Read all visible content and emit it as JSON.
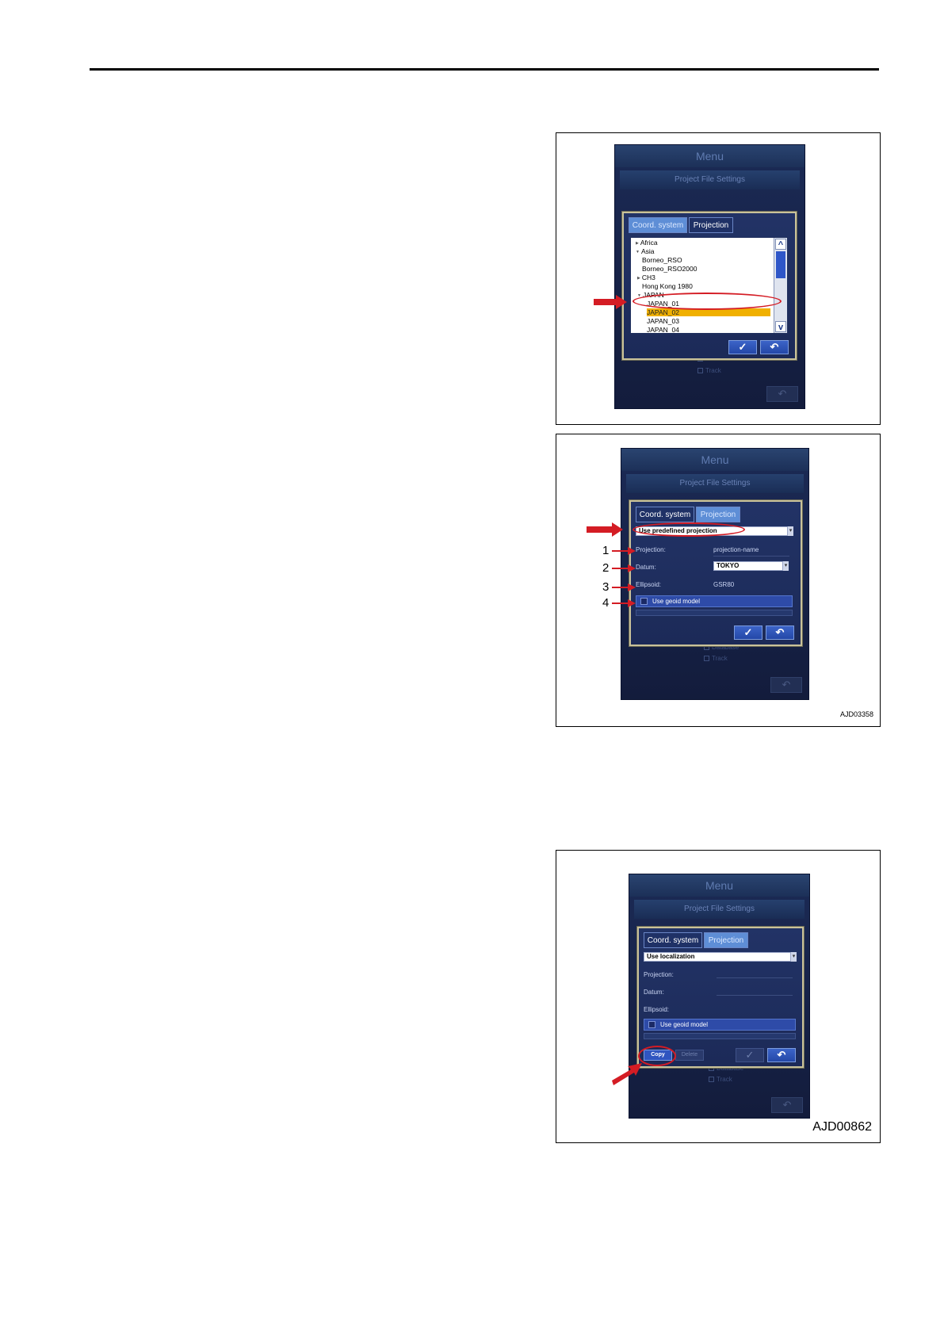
{
  "figure1": {
    "screen": {
      "menu_title": "Menu",
      "section_title": "Project File Settings",
      "tabs": [
        {
          "label": "Coord. system",
          "active": true
        },
        {
          "label": "Projection",
          "active": false
        }
      ],
      "tree_items": [
        {
          "label": "Africa",
          "expandable": true,
          "level": 0
        },
        {
          "label": "Asia",
          "expandable": true,
          "level": 0
        },
        {
          "label": "Borneo_RSO",
          "expandable": false,
          "level": 1
        },
        {
          "label": "Borneo_RSO2000",
          "expandable": false,
          "level": 1
        },
        {
          "label": "CH3",
          "expandable": true,
          "level": 1
        },
        {
          "label": "Hong Kong 1980",
          "expandable": false,
          "level": 1
        },
        {
          "label": "JAPAN",
          "expandable": true,
          "level": 1
        },
        {
          "label": "JAPAN_01",
          "expandable": false,
          "level": 2
        },
        {
          "label": "JAPAN_02",
          "expandable": false,
          "level": 2,
          "selected": true
        },
        {
          "label": "JAPAN_03",
          "expandable": false,
          "level": 2
        },
        {
          "label": "JAPAN_04",
          "expandable": false,
          "level": 2
        }
      ],
      "scroll_up": "^",
      "scroll_down": "v",
      "ok_glyph": "✓",
      "back_glyph": "↶",
      "ghost_checks": [
        "Database",
        "Track"
      ]
    }
  },
  "figure2": {
    "screen": {
      "menu_title": "Menu",
      "section_title": "Project File Settings",
      "tabs": [
        {
          "label": "Coord. system",
          "active": false
        },
        {
          "label": "Projection",
          "active": true
        }
      ],
      "mode_select": "Use predefined projection",
      "fields": [
        {
          "label": "Projection:",
          "value": "projection-name"
        },
        {
          "label": "Datum:",
          "value": "TOKYO"
        },
        {
          "label": "Ellipsoid:",
          "value": "GSR80"
        }
      ],
      "geoid_label": "Use geoid model",
      "ok_glyph": "✓",
      "back_glyph": "↶",
      "ghost_checks": [
        "Database",
        "Track"
      ]
    },
    "callouts": [
      "1",
      "2",
      "3",
      "4"
    ],
    "figure_id": "AJD03358"
  },
  "figure3": {
    "screen": {
      "menu_title": "Menu",
      "section_title": "Project File Settings",
      "tabs": [
        {
          "label": "Coord. system",
          "active": false
        },
        {
          "label": "Projection",
          "active": true
        }
      ],
      "mode_select": "Use localization",
      "fields": [
        {
          "label": "Projection:"
        },
        {
          "label": "Datum:"
        },
        {
          "label": "Ellipsoid:"
        }
      ],
      "geoid_label": "Use geoid model",
      "copy_label": "Copy",
      "delete_label": "Delete",
      "ok_glyph": "✓",
      "back_glyph": "↶",
      "ghost_checks": [
        "Database",
        "Track"
      ]
    },
    "figure_id": "AJD00862"
  },
  "colors": {
    "annotation_red": "#d41c24",
    "selection_highlight": "#f0b000",
    "screen_bg": "#1b2a55",
    "active_tab": "#5e8ed6"
  }
}
